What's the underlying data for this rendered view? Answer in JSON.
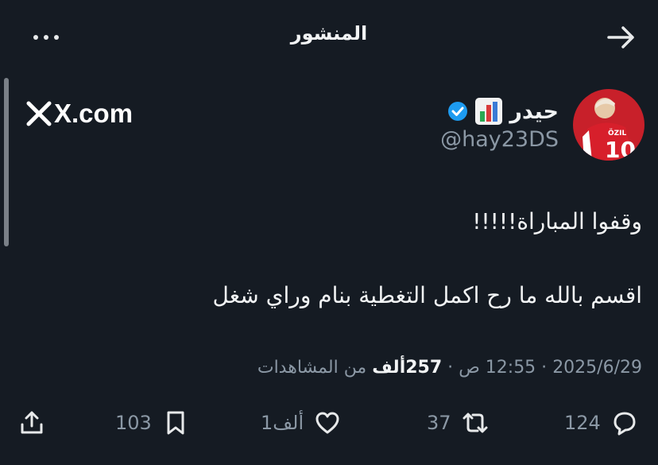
{
  "header": {
    "title": "المنشور"
  },
  "author": {
    "display_name": "حيدر",
    "handle": "@hay23DS"
  },
  "watermark": "X.com",
  "post": {
    "lines": [
      "وقفوا المباراة!!!!!",
      "اقسم بالله ما رح اكمل التغطية بنام وراي شغل"
    ]
  },
  "meta": {
    "date": "2025/6/29",
    "time": "12:55 ص",
    "views_count": "257ألف",
    "views_label": "من المشاهدات"
  },
  "actions": {
    "replies": "124",
    "reposts": "37",
    "likes": "1ألف",
    "bookmarks": "103"
  },
  "icons": [
    "more-icon",
    "back-arrow-icon",
    "verified-badge-icon",
    "bar-chart-emoji-icon",
    "x-logo-icon",
    "reply-icon",
    "repost-icon",
    "like-icon",
    "bookmark-icon",
    "share-icon"
  ],
  "colors": {
    "background": "#151b23",
    "text": "#e7e9ea",
    "muted": "#8b98a5",
    "verified": "#1d9bf0"
  }
}
